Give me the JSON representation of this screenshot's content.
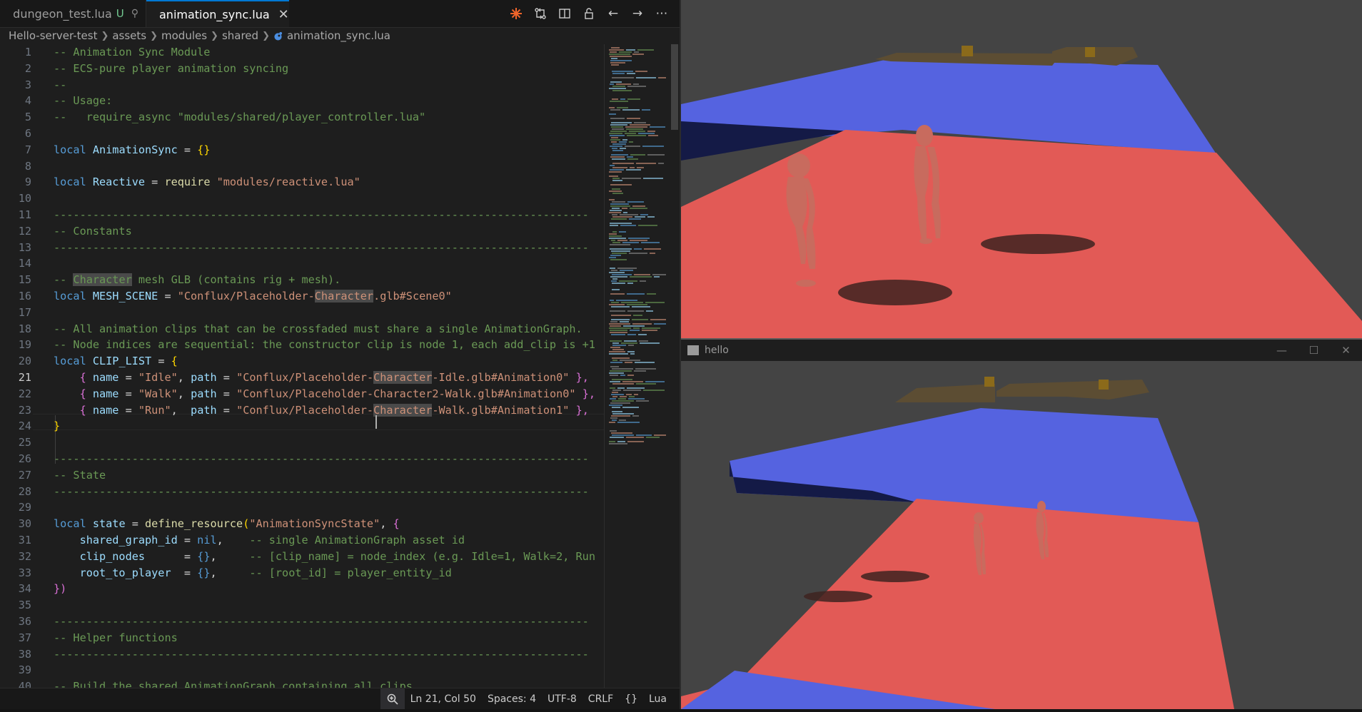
{
  "tabs": [
    {
      "label": "dungeon_test.lua",
      "badge": "U",
      "active": false
    },
    {
      "label": "animation_sync.lua",
      "active": true
    }
  ],
  "breadcrumbs": [
    "Hello-server-test",
    "assets",
    "modules",
    "shared",
    "animation_sync.lua"
  ],
  "editor_actions": [
    "spark-icon",
    "source-control-compare-icon",
    "split-editor-icon",
    "lock-icon",
    "go-back-icon",
    "go-forward-icon",
    "more-actions-icon"
  ],
  "code": {
    "current_line": 21,
    "lines": [
      {
        "n": "1",
        "segs": [
          {
            "t": "-- Animation Sync Module",
            "c": "c"
          }
        ]
      },
      {
        "n": "2",
        "segs": [
          {
            "t": "-- ECS-pure player animation syncing",
            "c": "c"
          }
        ]
      },
      {
        "n": "3",
        "segs": [
          {
            "t": "--",
            "c": "c"
          }
        ]
      },
      {
        "n": "4",
        "segs": [
          {
            "t": "-- Usage:",
            "c": "c"
          }
        ]
      },
      {
        "n": "5",
        "segs": [
          {
            "t": "--   require_async \"modules/shared/player_controller.lua\"",
            "c": "c"
          }
        ]
      },
      {
        "n": "6",
        "segs": []
      },
      {
        "n": "7",
        "segs": [
          {
            "t": "local ",
            "c": "k"
          },
          {
            "t": "AnimationSync",
            "c": "v"
          },
          {
            "t": " = ",
            "c": "p"
          },
          {
            "t": "{}",
            "c": "y"
          }
        ]
      },
      {
        "n": "8",
        "segs": []
      },
      {
        "n": "9",
        "segs": [
          {
            "t": "local ",
            "c": "k"
          },
          {
            "t": "Reactive",
            "c": "v"
          },
          {
            "t": " = ",
            "c": "p"
          },
          {
            "t": "require ",
            "c": "f"
          },
          {
            "t": "\"modules/reactive.lua\"",
            "c": "s"
          }
        ]
      },
      {
        "n": "10",
        "segs": []
      },
      {
        "n": "11",
        "segs": [
          {
            "t": "----------------------------------------------------------------------------------",
            "c": "c"
          }
        ]
      },
      {
        "n": "12",
        "segs": [
          {
            "t": "-- Constants",
            "c": "c"
          }
        ]
      },
      {
        "n": "13",
        "segs": [
          {
            "t": "----------------------------------------------------------------------------------",
            "c": "c"
          }
        ]
      },
      {
        "n": "14",
        "segs": []
      },
      {
        "n": "15",
        "segs": [
          {
            "t": "-- ",
            "c": "c"
          },
          {
            "t": "Character",
            "c": "c hl"
          },
          {
            "t": " mesh GLB (contains rig + mesh).",
            "c": "c"
          }
        ]
      },
      {
        "n": "16",
        "segs": [
          {
            "t": "local ",
            "c": "k"
          },
          {
            "t": "MESH_SCENE",
            "c": "v"
          },
          {
            "t": " = ",
            "c": "p"
          },
          {
            "t": "\"Conflux/Placeholder-",
            "c": "s"
          },
          {
            "t": "Character",
            "c": "s hl"
          },
          {
            "t": ".glb#Scene0\"",
            "c": "s"
          }
        ]
      },
      {
        "n": "17",
        "segs": []
      },
      {
        "n": "18",
        "segs": [
          {
            "t": "-- All animation clips that can be crossfaded must share a single AnimationGraph.",
            "c": "c"
          }
        ]
      },
      {
        "n": "19",
        "segs": [
          {
            "t": "-- Node indices are sequential: the constructor clip is node 1, each add_clip is +1",
            "c": "c"
          }
        ]
      },
      {
        "n": "20",
        "segs": [
          {
            "t": "local ",
            "c": "k"
          },
          {
            "t": "CLIP_LIST",
            "c": "v"
          },
          {
            "t": " = ",
            "c": "p"
          },
          {
            "t": "{",
            "c": "y"
          }
        ]
      },
      {
        "n": "21",
        "segs": [
          {
            "t": "    ",
            "c": "p"
          },
          {
            "t": "{ ",
            "c": "b"
          },
          {
            "t": "name",
            "c": "v"
          },
          {
            "t": " = ",
            "c": "p"
          },
          {
            "t": "\"Idle\"",
            "c": "s"
          },
          {
            "t": ", ",
            "c": "p"
          },
          {
            "t": "path",
            "c": "v"
          },
          {
            "t": " = ",
            "c": "p"
          },
          {
            "t": "\"Conflux/Placeholder-",
            "c": "s"
          },
          {
            "t": "Character",
            "c": "s hl"
          },
          {
            "t": "-Idle.glb#Animation0\"",
            "c": "s"
          },
          {
            "t": " },",
            "c": "b"
          }
        ]
      },
      {
        "n": "22",
        "segs": [
          {
            "t": "    ",
            "c": "p"
          },
          {
            "t": "{ ",
            "c": "b"
          },
          {
            "t": "name",
            "c": "v"
          },
          {
            "t": " = ",
            "c": "p"
          },
          {
            "t": "\"Walk\"",
            "c": "s"
          },
          {
            "t": ", ",
            "c": "p"
          },
          {
            "t": "path",
            "c": "v"
          },
          {
            "t": " = ",
            "c": "p"
          },
          {
            "t": "\"Conflux/Placeholder-Character2-Walk.glb#Animation0\"",
            "c": "s"
          },
          {
            "t": " },",
            "c": "b"
          }
        ]
      },
      {
        "n": "23",
        "segs": [
          {
            "t": "    ",
            "c": "p"
          },
          {
            "t": "{ ",
            "c": "b"
          },
          {
            "t": "name",
            "c": "v"
          },
          {
            "t": " = ",
            "c": "p"
          },
          {
            "t": "\"Run\"",
            "c": "s"
          },
          {
            "t": ",  ",
            "c": "p"
          },
          {
            "t": "path",
            "c": "v"
          },
          {
            "t": " = ",
            "c": "p"
          },
          {
            "t": "\"Conflux/Placeholder-",
            "c": "s"
          },
          {
            "t": "Character",
            "c": "s hl"
          },
          {
            "t": "-Walk.glb#Animation1\"",
            "c": "s"
          },
          {
            "t": " },",
            "c": "b"
          }
        ]
      },
      {
        "n": "24",
        "segs": [
          {
            "t": "}",
            "c": "y"
          }
        ]
      },
      {
        "n": "25",
        "segs": []
      },
      {
        "n": "26",
        "segs": [
          {
            "t": "----------------------------------------------------------------------------------",
            "c": "c"
          }
        ]
      },
      {
        "n": "27",
        "segs": [
          {
            "t": "-- State",
            "c": "c"
          }
        ]
      },
      {
        "n": "28",
        "segs": [
          {
            "t": "----------------------------------------------------------------------------------",
            "c": "c"
          }
        ]
      },
      {
        "n": "29",
        "segs": []
      },
      {
        "n": "30",
        "segs": [
          {
            "t": "local ",
            "c": "k"
          },
          {
            "t": "state",
            "c": "v"
          },
          {
            "t": " = ",
            "c": "p"
          },
          {
            "t": "define_resource",
            "c": "f"
          },
          {
            "t": "(",
            "c": "y"
          },
          {
            "t": "\"AnimationSyncState\"",
            "c": "s"
          },
          {
            "t": ", ",
            "c": "p"
          },
          {
            "t": "{",
            "c": "b"
          }
        ]
      },
      {
        "n": "31",
        "segs": [
          {
            "t": "    shared_graph_id",
            "c": "v"
          },
          {
            "t": " = ",
            "c": "p"
          },
          {
            "t": "nil",
            "c": "k"
          },
          {
            "t": ",    ",
            "c": "p"
          },
          {
            "t": "-- single AnimationGraph asset id",
            "c": "c"
          }
        ]
      },
      {
        "n": "32",
        "segs": [
          {
            "t": "    clip_nodes",
            "c": "v"
          },
          {
            "t": "      = ",
            "c": "p"
          },
          {
            "t": "{}",
            "c": "k"
          },
          {
            "t": ",     ",
            "c": "p"
          },
          {
            "t": "-- [clip_name] = node_index (e.g. Idle=1, Walk=2, Run",
            "c": "c"
          }
        ]
      },
      {
        "n": "33",
        "segs": [
          {
            "t": "    root_to_player",
            "c": "v"
          },
          {
            "t": "  = ",
            "c": "p"
          },
          {
            "t": "{}",
            "c": "k"
          },
          {
            "t": ",     ",
            "c": "p"
          },
          {
            "t": "-- [root_id] = player_entity_id",
            "c": "c"
          }
        ]
      },
      {
        "n": "34",
        "segs": [
          {
            "t": "})",
            "c": "b"
          }
        ]
      },
      {
        "n": "35",
        "segs": []
      },
      {
        "n": "36",
        "segs": [
          {
            "t": "----------------------------------------------------------------------------------",
            "c": "c"
          }
        ]
      },
      {
        "n": "37",
        "segs": [
          {
            "t": "-- Helper functions",
            "c": "c"
          }
        ]
      },
      {
        "n": "38",
        "segs": [
          {
            "t": "----------------------------------------------------------------------------------",
            "c": "c"
          }
        ]
      },
      {
        "n": "39",
        "segs": []
      },
      {
        "n": "40",
        "segs": [
          {
            "t": "-- Build the shared AnimationGraph containing all clips",
            "c": "c"
          }
        ]
      }
    ]
  },
  "statusbar": {
    "position": "Ln 21, Col 50",
    "spaces": "Spaces: 4",
    "encoding": "UTF-8",
    "eol": "CRLF",
    "braces": "{}",
    "language": "Lua"
  },
  "window": {
    "title": "hello",
    "controls": [
      "minimize-icon",
      "maximize-icon",
      "close-icon"
    ]
  },
  "colors": {
    "accent": "#0078d4",
    "floor_red": "#e25a56",
    "floor_blue": "#5563e0",
    "character": "#c86b5e"
  }
}
